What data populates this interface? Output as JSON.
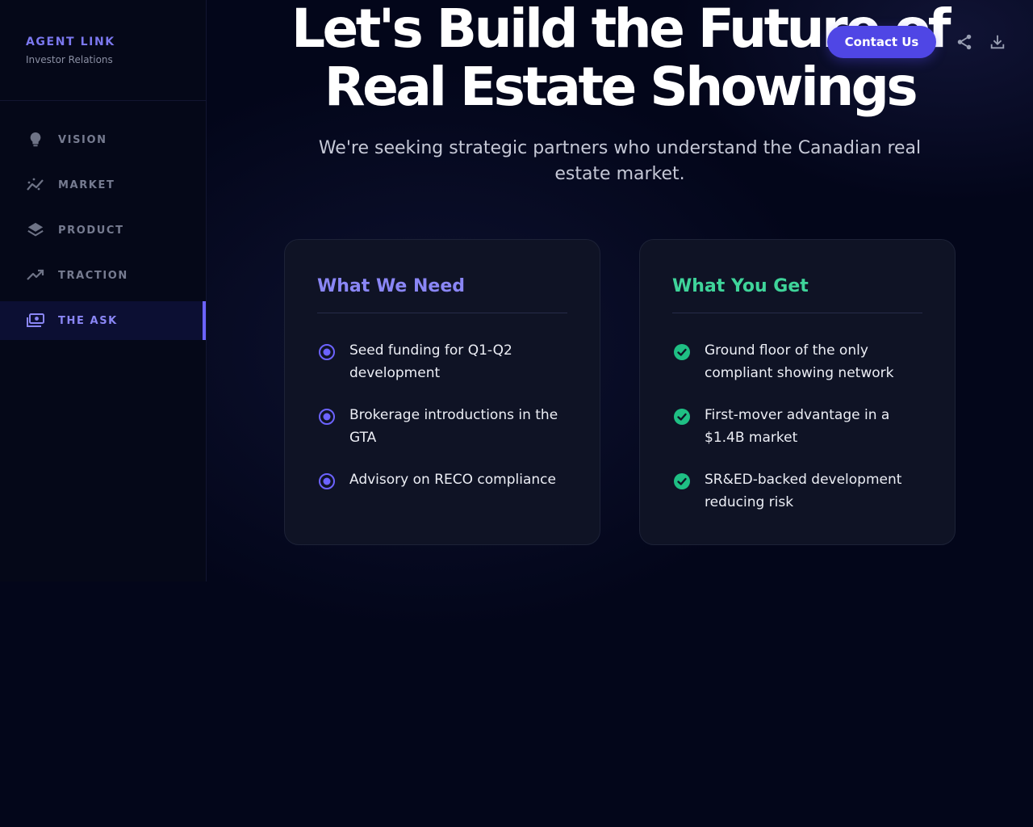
{
  "brand": {
    "title": "AGENT LINK",
    "subtitle": "Investor Relations"
  },
  "sidebar": {
    "items": [
      {
        "label": "VISION",
        "icon": "lightbulb-icon",
        "active": false
      },
      {
        "label": "MARKET",
        "icon": "chart-line-icon",
        "active": false
      },
      {
        "label": "PRODUCT",
        "icon": "layers-icon",
        "active": false
      },
      {
        "label": "TRACTION",
        "icon": "trending-up-icon",
        "active": false
      },
      {
        "label": "THE ASK",
        "icon": "cash-icon",
        "active": true
      }
    ]
  },
  "header": {
    "contact_label": "Contact Us",
    "share_icon": "share-icon",
    "download_icon": "download-icon"
  },
  "hero": {
    "title_line1": "Let's Build the Future of",
    "title_line2": "Real Estate Showings",
    "subtitle": "We're seeking strategic partners who understand the Canadian real estate market."
  },
  "needs": {
    "title": "What We Need",
    "items": [
      "Seed funding for Q1-Q2 development",
      "Brokerage introductions in the GTA",
      "Advisory on RECO compliance"
    ]
  },
  "gets": {
    "title": "What You Get",
    "items": [
      "Ground floor of the only compliant showing network",
      "First-mover advantage in a $1.4B market",
      "SR&ED-backed development reducing risk"
    ]
  },
  "colors": {
    "background": "#03061a",
    "accent": "#4f46e5",
    "accent_light": "#8a86f5",
    "success": "#3fd49a",
    "card": "#0f1325"
  }
}
